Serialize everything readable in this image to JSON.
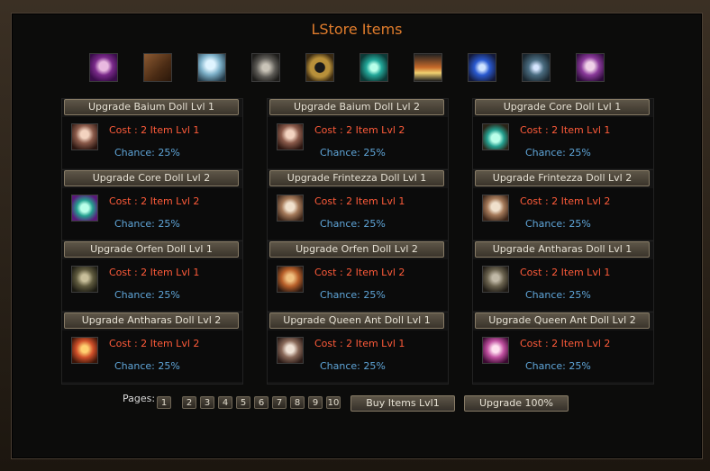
{
  "title": "LStore Items",
  "top_icons": [
    "purple-doll-icon",
    "wooden-box-icon",
    "crystal-icon",
    "metal-armor-icon",
    "gold-ring-icon",
    "teal-orb-icon",
    "triangle-gem-icon",
    "blue-gem-icon",
    "star-rune-icon",
    "purple-doll-icon"
  ],
  "items": [
    {
      "name": "Upgrade Baium Doll Lvl 1",
      "cost": "Cost : 2 Item Lvl 1",
      "chance": "Chance: 25%",
      "icon": "baium-doll-icon"
    },
    {
      "name": "Upgrade Baium Doll Lvl 2",
      "cost": "Cost : 2 Item Lvl 2",
      "chance": "Chance: 25%",
      "icon": "baium-doll-icon"
    },
    {
      "name": "Upgrade Core Doll Lvl 1",
      "cost": "Cost : 2 Item Lvl 1",
      "chance": "Chance: 25%",
      "icon": "core-doll-icon"
    },
    {
      "name": "Upgrade Core Doll Lvl 2",
      "cost": "Cost : 2 Item Lvl 2",
      "chance": "Chance: 25%",
      "icon": "core-doll-icon"
    },
    {
      "name": "Upgrade Frintezza Doll Lvl 1",
      "cost": "Cost : 2 Item Lvl 1",
      "chance": "Chance: 25%",
      "icon": "frintezza-doll-icon"
    },
    {
      "name": "Upgrade Frintezza Doll Lvl 2",
      "cost": "Cost : 2 Item Lvl 2",
      "chance": "Chance: 25%",
      "icon": "frintezza-doll-icon"
    },
    {
      "name": "Upgrade Orfen Doll Lvl 1",
      "cost": "Cost : 2 Item Lvl 1",
      "chance": "Chance: 25%",
      "icon": "orfen-doll-icon"
    },
    {
      "name": "Upgrade Orfen Doll Lvl 2",
      "cost": "Cost : 2 Item Lvl 2",
      "chance": "Chance: 25%",
      "icon": "orfen-doll-icon"
    },
    {
      "name": "Upgrade Antharas Doll Lvl 1",
      "cost": "Cost : 2 Item Lvl 1",
      "chance": "Chance: 25%",
      "icon": "antharas-doll-icon"
    },
    {
      "name": "Upgrade Antharas Doll Lvl 2",
      "cost": "Cost : 2 Item Lvl 2",
      "chance": "Chance: 25%",
      "icon": "antharas-doll-icon"
    },
    {
      "name": "Upgrade Queen Ant Doll Lvl 1",
      "cost": "Cost : 2 Item Lvl 1",
      "chance": "Chance: 25%",
      "icon": "queen-ant-doll-icon"
    },
    {
      "name": "Upgrade Queen Ant Doll Lvl 2",
      "cost": "Cost : 2 Item Lvl 2",
      "chance": "Chance: 25%",
      "icon": "queen-ant-doll-icon"
    }
  ],
  "pagination": {
    "label": "Pages:",
    "pages": [
      "1",
      "2",
      "3",
      "4",
      "5",
      "6",
      "7",
      "8",
      "9",
      "10"
    ]
  },
  "buttons": {
    "buy": "Buy Items Lvl1",
    "upgrade": "Upgrade 100%"
  }
}
